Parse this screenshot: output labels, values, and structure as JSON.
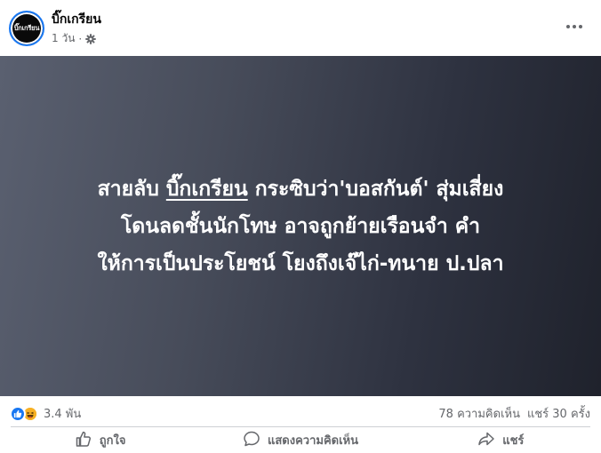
{
  "post": {
    "author": "บิ๊กเกรียน",
    "avatar_text": "บิ๊กเกรียน",
    "time": "1 วัน",
    "separator": "·",
    "privacy_icon": "gear-icon",
    "more_icon": "more-horizontal-icon"
  },
  "media": {
    "line1_pre": "สายลับ ",
    "line1_underlined": "บิ๊กเกรียน",
    "line1_post": " กระซิบว่า'บอสกันต์' สุ่มเสี่ยง",
    "line2": "โดนลดชั้นนักโทษ อาจถูกย้ายเรือนจำ คำ",
    "line3": "ให้การเป็นประโยชน์ โยงถึงเจ๊ไก่-ทนาย ป.ปลา"
  },
  "stats": {
    "reactions": "3.4 พัน",
    "comments": "78 ความคิดเห็น",
    "shares": "แชร์ 30 ครั้ง"
  },
  "actions": {
    "like": "ถูกใจ",
    "comment": "แสดงความคิดเห็น",
    "share": "แชร์"
  },
  "colors": {
    "accent": "#1877f2",
    "secondary_text": "#65676b",
    "haha": "#f7b125"
  }
}
